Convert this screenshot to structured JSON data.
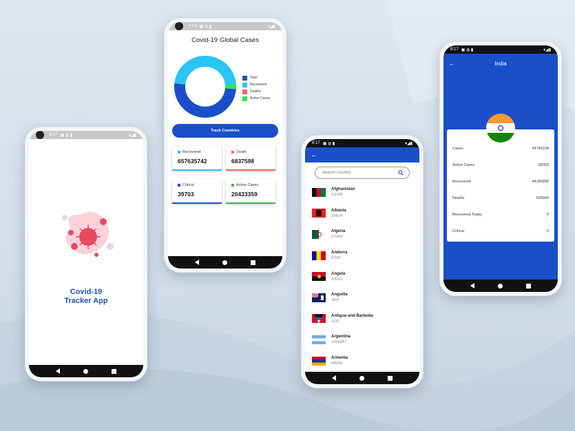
{
  "status_time_a": "8:17",
  "status_time_b": "8:16",
  "splash": {
    "title_line1": "Covid-19",
    "title_line2": "Tracker App"
  },
  "global": {
    "title": "Covid-19 Global Cases",
    "legend": [
      {
        "label": "Total",
        "color": "#1a4fc9"
      },
      {
        "label": "Recovered",
        "color": "#29c5f6"
      },
      {
        "label": "Deaths",
        "color": "#f26a6a"
      },
      {
        "label": "Active Cases",
        "color": "#2ee84a"
      }
    ],
    "track_button": "Track Countries",
    "stats": [
      {
        "label": "Recovered",
        "value": "657635742",
        "color": "#29c5f6"
      },
      {
        "label": "Death",
        "value": "6837598",
        "color": "#f26a6a"
      },
      {
        "label": "Critical",
        "value": "39703",
        "color": "#1a4fc9"
      },
      {
        "label": "Active Cases",
        "value": "20433359",
        "color": "#4caf50"
      }
    ]
  },
  "countries": {
    "search_placeholder": "Search Country",
    "items": [
      {
        "name": "Afghanistan",
        "count": "211498"
      },
      {
        "name": "Albania",
        "count": "334674"
      },
      {
        "name": "Algeria",
        "count": "271603"
      },
      {
        "name": "Andorra",
        "count": "47030"
      },
      {
        "name": "Angola",
        "count": "105351"
      },
      {
        "name": "Anguilla",
        "count": "3904"
      },
      {
        "name": "Antigua and Barbuda",
        "count": "9126"
      },
      {
        "name": "Argentina",
        "count": "10044957"
      },
      {
        "name": "Armenia",
        "count": "446456"
      }
    ]
  },
  "india": {
    "title": "India",
    "rows": [
      {
        "label": "Cases",
        "value": "44745104"
      },
      {
        "label": "Active Cases",
        "value": "28303"
      },
      {
        "label": "Recovered",
        "value": "44185858"
      },
      {
        "label": "Deaths",
        "value": "530943"
      },
      {
        "label": "Recovered Today",
        "value": "0"
      },
      {
        "label": "Critical",
        "value": "0"
      }
    ]
  },
  "icons": {
    "back": "back-arrow-icon",
    "search": "search-icon",
    "virus": "virus-illustration"
  }
}
